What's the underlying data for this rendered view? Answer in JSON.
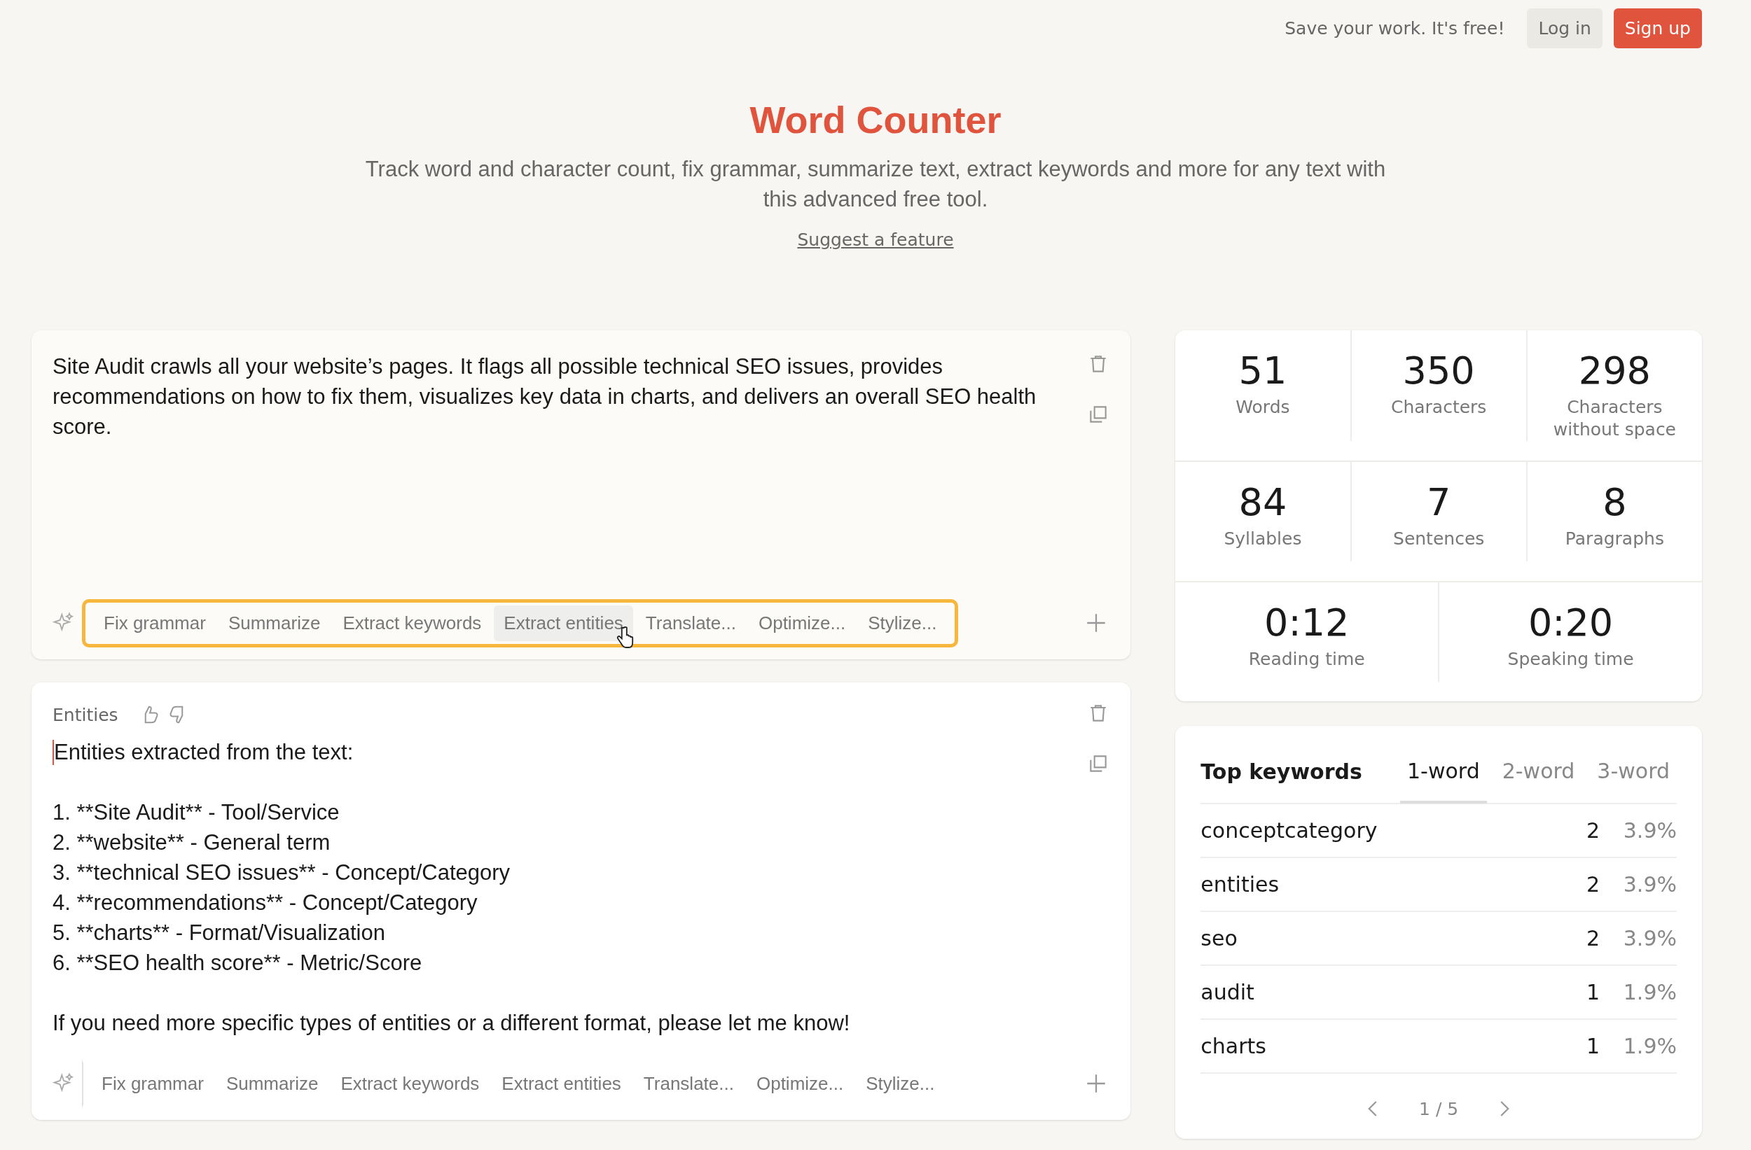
{
  "header": {
    "tagline": "Save your work. It's free!",
    "buttons": [
      {
        "label": "Log in",
        "kind": "secondary"
      },
      {
        "label": "Sign up",
        "kind": "primary"
      }
    ]
  },
  "hero": {
    "title": "Word Counter",
    "subtitle": "Track word and character count, fix grammar, summarize text, extract keywords and more for any text with this advanced free tool.",
    "link": "Suggest a feature"
  },
  "editor": {
    "text": "Site Audit crawls all your website’s pages. It flags all possible technical SEO issues, provides recommendations on how to fix them, visualizes key data in charts, and delivers an overall SEO health score.",
    "toolbar": {
      "highlighted": true,
      "actions": [
        {
          "label": "Fix grammar",
          "hovered": false
        },
        {
          "label": "Summarize",
          "hovered": false
        },
        {
          "label": "Extract keywords",
          "hovered": false
        },
        {
          "label": "Extract entities",
          "hovered": true
        },
        {
          "label": "Translate...",
          "hovered": false
        },
        {
          "label": "Optimize...",
          "hovered": false
        },
        {
          "label": "Stylize...",
          "hovered": false
        }
      ]
    }
  },
  "output": {
    "label": "Entities",
    "intro": "Entities extracted from the text:",
    "items": [
      "1. **Site Audit** - Tool/Service",
      "2. **website** - General term",
      "3. **technical SEO issues** - Concept/Category",
      "4. **recommendations** - Concept/Category",
      "5. **charts** - Format/Visualization",
      "6. **SEO health score** - Metric/Score"
    ],
    "closing": "If you need more specific types of entities or a different format, please let me know!",
    "toolbar": {
      "highlighted": false,
      "actions": [
        {
          "label": "Fix grammar",
          "hovered": false
        },
        {
          "label": "Summarize",
          "hovered": false
        },
        {
          "label": "Extract keywords",
          "hovered": false
        },
        {
          "label": "Extract entities",
          "hovered": false
        },
        {
          "label": "Translate...",
          "hovered": false
        },
        {
          "label": "Optimize...",
          "hovered": false
        },
        {
          "label": "Stylize...",
          "hovered": false
        }
      ]
    }
  },
  "stats": [
    [
      {
        "value": "51",
        "label": "Words"
      },
      {
        "value": "350",
        "label": "Characters"
      },
      {
        "value": "298",
        "label": "Characters without space"
      }
    ],
    [
      {
        "value": "84",
        "label": "Syllables"
      },
      {
        "value": "7",
        "label": "Sentences"
      },
      {
        "value": "8",
        "label": "Paragraphs"
      }
    ],
    [
      {
        "value": "0:12",
        "label": "Reading time"
      },
      {
        "value": "0:20",
        "label": "Speaking time"
      }
    ]
  ],
  "keywords": {
    "title": "Top keywords",
    "tabs": [
      {
        "label": "1-word",
        "selected": true
      },
      {
        "label": "2-word",
        "selected": false
      },
      {
        "label": "3-word",
        "selected": false
      }
    ],
    "rows": [
      {
        "word": "conceptcategory",
        "count": "2",
        "percent": "3.9%"
      },
      {
        "word": "entities",
        "count": "2",
        "percent": "3.9%"
      },
      {
        "word": "seo",
        "count": "2",
        "percent": "3.9%"
      },
      {
        "word": "audit",
        "count": "1",
        "percent": "1.9%"
      },
      {
        "word": "charts",
        "count": "1",
        "percent": "1.9%"
      }
    ],
    "page": "1 / 5"
  }
}
